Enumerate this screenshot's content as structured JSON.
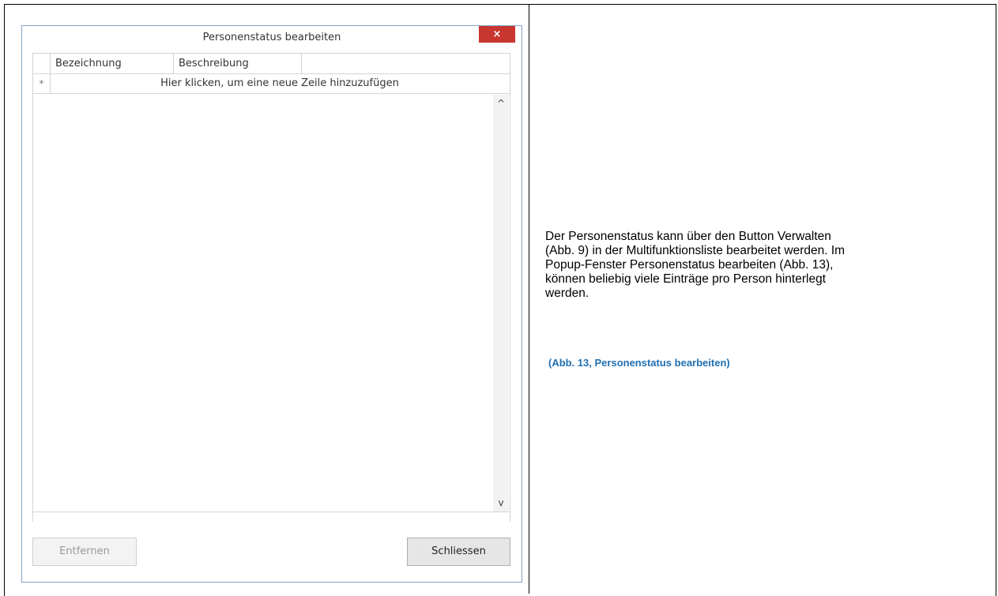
{
  "dialog": {
    "faded_text": "",
    "title": "Personenstatus bearbeiten",
    "close_label": "×",
    "grid": {
      "columns": [
        "Bezeichnung",
        "Beschreibung"
      ],
      "new_row_marker": "*",
      "new_row_text": "Hier klicken, um eine neue Zeile hinzuzufügen",
      "scroll_up": "^",
      "scroll_down": "v"
    },
    "buttons": {
      "remove": "Entfernen",
      "close": "Schliessen"
    }
  },
  "description": {
    "lines": [
      "Der Personenstatus kann über den Button Verwalten",
      "(Abb. 9) in der Multifunktionsliste bearbeitet werden. Im",
      "Popup-Fenster Personenstatus bearbeiten (Abb. 13),",
      "können beliebig viele Einträge pro Person hinterlegt",
      "werden."
    ],
    "caption": "(Abb. 13, Personenstatus bearbeiten)"
  },
  "colors": {
    "close_button": "#c9352f",
    "caption": "#1f6fb2",
    "dialog_border": "#7fa3c9"
  }
}
